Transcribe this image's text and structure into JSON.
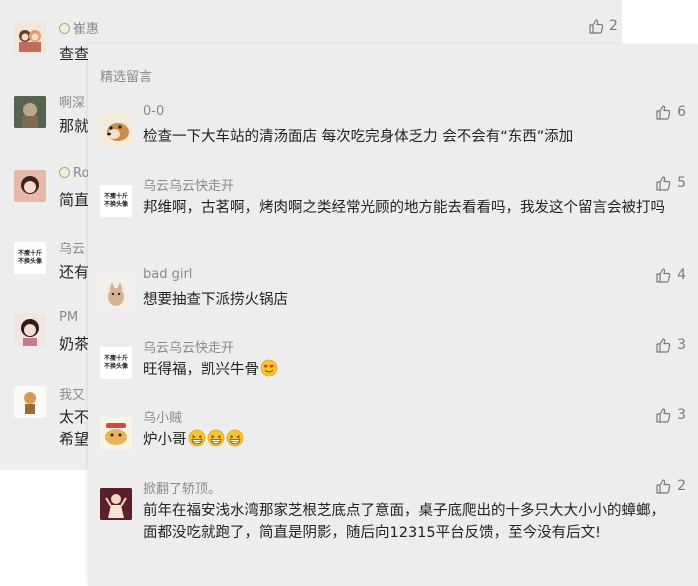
{
  "background": {
    "comments": [
      {
        "name": "崔惠",
        "badge": true,
        "text": "查查",
        "likes": "2"
      },
      {
        "name": "啊深",
        "badge": false,
        "text": "那就",
        "likes": ""
      },
      {
        "name": "Ro",
        "badge": true,
        "text": "简直",
        "likes": ""
      },
      {
        "name": "乌云",
        "badge": false,
        "text": "还有",
        "likes": ""
      },
      {
        "name": "PM",
        "badge": false,
        "text": "奶茶",
        "likes": ""
      },
      {
        "name": "我又",
        "badge": false,
        "text": "太不",
        "text2": "希望",
        "likes": ""
      }
    ]
  },
  "panel": {
    "section_title": "精选留言",
    "comments": [
      {
        "name": "0-0",
        "text": "检查一下大车站的清汤面店 每次吃完身体乏力 会不会有“东西”添加",
        "likes": "6",
        "avatar": "dog-avatar"
      },
      {
        "name": "乌云乌云快走开",
        "text": "邦维啊，古茗啊，烤肉啊之类经常光顾的地方能去看看吗，我发这个留言会被打吗",
        "likes": "5",
        "avatar": "text-avatar",
        "avatar_text": [
          "不瘦十斤",
          "不换头像"
        ]
      },
      {
        "name": "bad girl",
        "text": "想要抽查下派捞火锅店",
        "likes": "4",
        "avatar": "cat-avatar"
      },
      {
        "name": "乌云乌云快走开",
        "text": "旺得福，凯兴牛骨",
        "likes": "3",
        "avatar": "text-avatar",
        "avatar_text": [
          "不瘦十斤",
          "不换头像"
        ],
        "emoji_count": 1
      },
      {
        "name": "乌小贼",
        "text": "炉小哥",
        "likes": "3",
        "avatar": "cartoon-avatar",
        "emoji_count": 3
      },
      {
        "name": "掀翻了轿顶。",
        "text": "前年在福安浅水湾那家芝根芝底点了意面，桌子底爬出的十多只大大小小的蟑螂，面都没吃就跑了，简直是阴影，随后向12315平台反馈，至今没有后文!",
        "likes": "2",
        "avatar": "figure-avatar"
      }
    ]
  },
  "colors": {
    "background": "#ededed",
    "name": "#8a8a8a",
    "text": "#222222",
    "like": "#7a7a7a"
  }
}
